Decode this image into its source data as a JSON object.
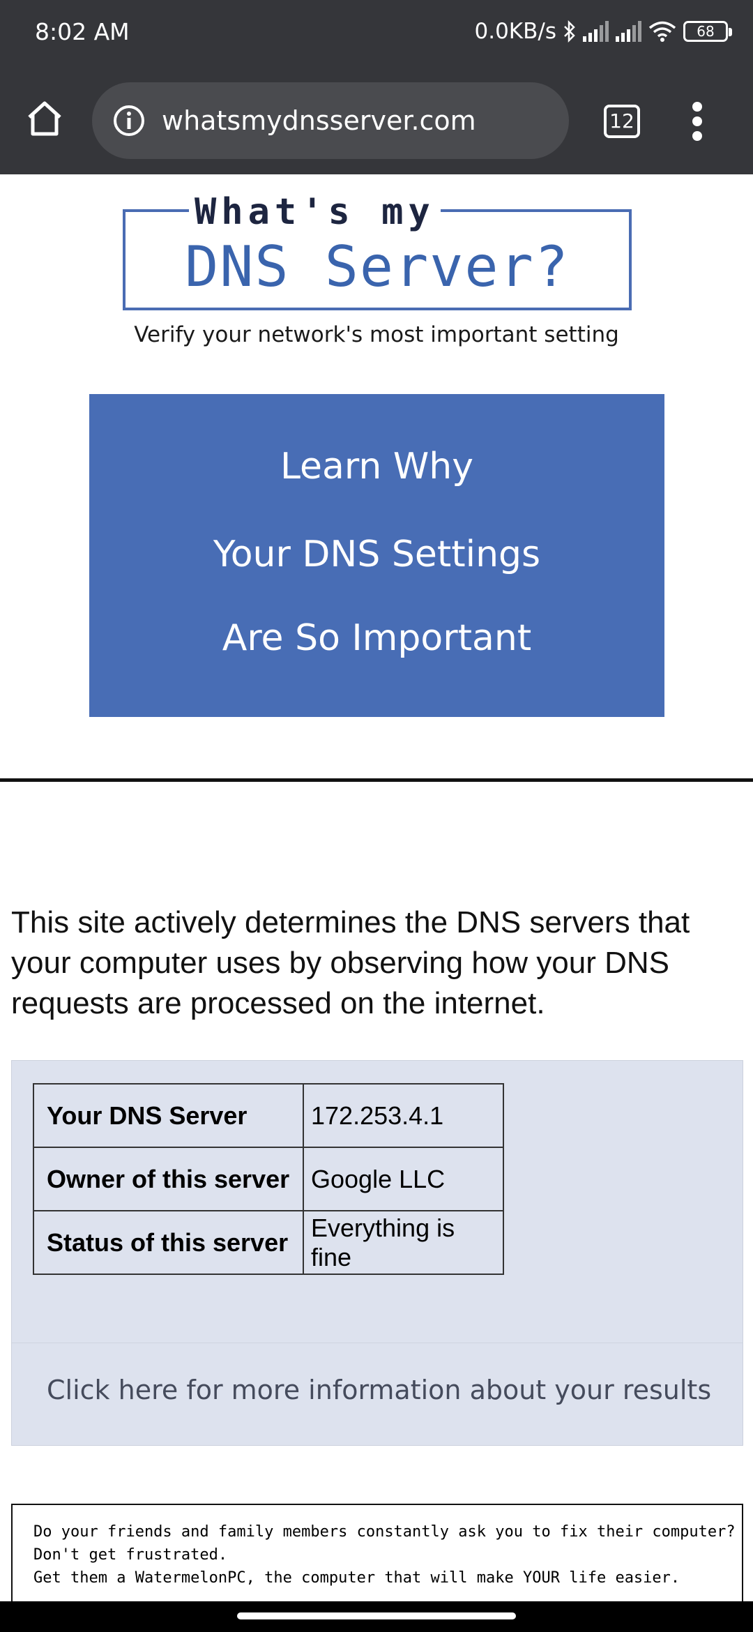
{
  "status_bar": {
    "time": "8:02 AM",
    "network_speed": "0.0KB/s",
    "battery": "68",
    "icons": [
      "bluetooth-icon",
      "signal-icon",
      "signal-icon",
      "wifi-icon",
      "battery-icon"
    ]
  },
  "browser": {
    "url": "whatsmydnsserver.com",
    "tab_count": "12",
    "icons": [
      "home-icon",
      "info-icon",
      "tabs-icon",
      "more-vert-icon"
    ]
  },
  "logo": {
    "top_text": "What's my",
    "main_text": "DNS Server?",
    "tagline": "Verify your network's most important setting",
    "color": "#3a64ad"
  },
  "banner": {
    "lines": [
      "Learn Why",
      "Your DNS Settings",
      "Are So Important"
    ],
    "background": "#486db5"
  },
  "intro_text": "This site actively determines the DNS servers that your computer uses by observing how your DNS requests are processed on the internet.",
  "results": {
    "rows": [
      {
        "label": "Your DNS Server",
        "value": "172.253.4.1"
      },
      {
        "label": "Owner of this server",
        "value": "Google LLC"
      },
      {
        "label": "Status of this server",
        "value": "Everything is fine"
      }
    ],
    "more_info_link": "Click here for more information about your results",
    "background": "#dde2ee"
  },
  "ad": {
    "lines": [
      "Do your friends and family members constantly ask you to fix their computer?",
      "Don't get frustrated.",
      "Get them a WatermelonPC, the computer that will make YOUR life easier."
    ]
  }
}
